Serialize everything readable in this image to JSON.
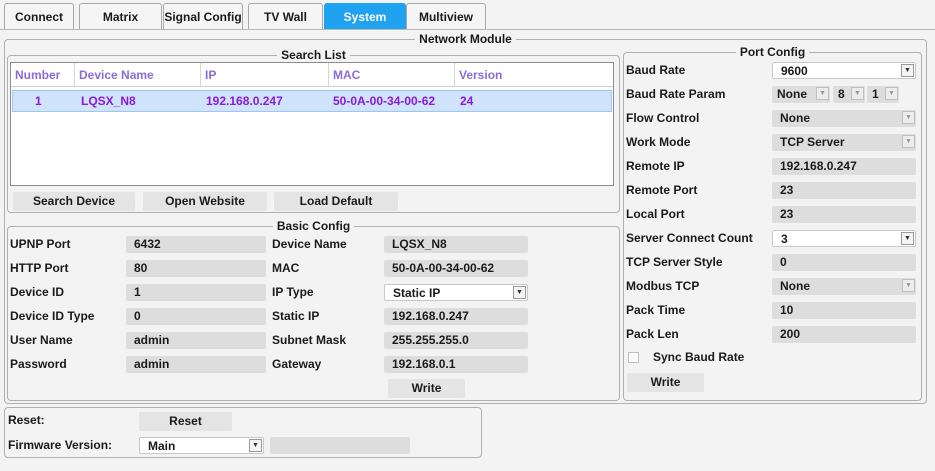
{
  "tabs": [
    {
      "label": "Connect"
    },
    {
      "label": "Matrix"
    },
    {
      "label": "Signal Config"
    },
    {
      "label": "TV Wall"
    },
    {
      "label": "System"
    },
    {
      "label": "Multiview"
    }
  ],
  "active_tab": "System",
  "network_module": {
    "title": "Network Module",
    "search_list": {
      "title": "Search List",
      "columns": [
        "Number",
        "Device Name",
        "IP",
        "MAC",
        "Version"
      ],
      "rows": [
        {
          "number": "1",
          "device_name": "LQSX_N8",
          "ip": "192.168.0.247",
          "mac": "50-0A-00-34-00-62",
          "version": "24"
        }
      ],
      "buttons": {
        "search_device": "Search Device",
        "open_website": "Open Website",
        "load_default": "Load Default"
      }
    },
    "basic_config": {
      "title": "Basic Config",
      "left": [
        {
          "label": "UPNP Port",
          "value": "6432"
        },
        {
          "label": "HTTP Port",
          "value": "80"
        },
        {
          "label": "Device ID",
          "value": "1"
        },
        {
          "label": "Device ID Type",
          "value": "0"
        },
        {
          "label": "User Name",
          "value": "admin"
        },
        {
          "label": "Password",
          "value": "admin"
        }
      ],
      "right": [
        {
          "label": "Device Name",
          "value": "LQSX_N8"
        },
        {
          "label": "MAC",
          "value": "50-0A-00-34-00-62"
        },
        {
          "label": "IP Type",
          "value": "Static IP"
        },
        {
          "label": "Static IP",
          "value": "192.168.0.247"
        },
        {
          "label": "Subnet Mask",
          "value": "255.255.255.0"
        },
        {
          "label": "Gateway",
          "value": "192.168.0.1"
        }
      ],
      "write_label": "Write"
    },
    "port_config": {
      "title": "Port Config",
      "baud_rate": {
        "label": "Baud Rate",
        "value": "9600"
      },
      "baud_rate_param": {
        "label": "Baud Rate Param",
        "parity": "None",
        "data_bits": "8",
        "stop_bits": "1"
      },
      "flow_control": {
        "label": "Flow Control",
        "value": "None"
      },
      "work_mode": {
        "label": "Work Mode",
        "value": "TCP Server"
      },
      "remote_ip": {
        "label": "Remote IP",
        "value": "192.168.0.247"
      },
      "remote_port": {
        "label": "Remote Port",
        "value": "23"
      },
      "local_port": {
        "label": "Local Port",
        "value": "23"
      },
      "server_connect_count": {
        "label": "Server Connect Count",
        "value": "3"
      },
      "tcp_server_style": {
        "label": "TCP Server Style",
        "value": "0"
      },
      "modbus_tcp": {
        "label": "Modbus TCP",
        "value": "None"
      },
      "pack_time": {
        "label": "Pack Time",
        "value": "10"
      },
      "pack_len": {
        "label": "Pack Len",
        "value": "200"
      },
      "sync_baud_rate": {
        "label": "Sync Baud Rate",
        "checked": false
      },
      "write_label": "Write"
    }
  },
  "reset_section": {
    "reset_label": "Reset:",
    "reset_button": "Reset",
    "firmware_label": "Firmware Version:",
    "firmware_value": "Main",
    "firmware_extra": ""
  },
  "colors": {
    "accent": "#1fa2f0",
    "header_text": "#8b6cd8",
    "row_text": "#8a1ad8",
    "row_selected": "#cfe3fb"
  },
  "icons": {
    "dropdown": "chevron-down-icon",
    "checkbox": "checkbox-icon"
  }
}
